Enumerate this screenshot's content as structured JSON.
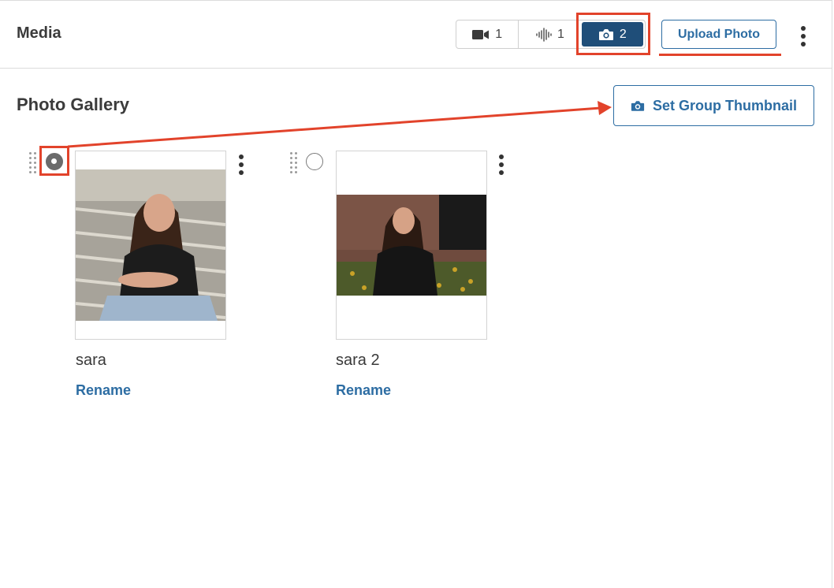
{
  "header": {
    "title": "Media",
    "tabs": [
      {
        "icon": "video-camera-icon",
        "count": "1"
      },
      {
        "icon": "audio-waveform-icon",
        "count": "1"
      },
      {
        "icon": "camera-icon",
        "count": "2",
        "active": true
      }
    ],
    "upload_label": "Upload Photo"
  },
  "gallery": {
    "title": "Photo Gallery",
    "thumbnail_button_label": "Set Group Thumbnail",
    "items": [
      {
        "name": "sara",
        "rename_label": "Rename",
        "selected": true
      },
      {
        "name": "sara 2",
        "rename_label": "Rename",
        "selected": false
      }
    ]
  },
  "colors": {
    "accent": "#2d6da3",
    "active_tab": "#1f4e79",
    "highlight": "#e2432b"
  }
}
